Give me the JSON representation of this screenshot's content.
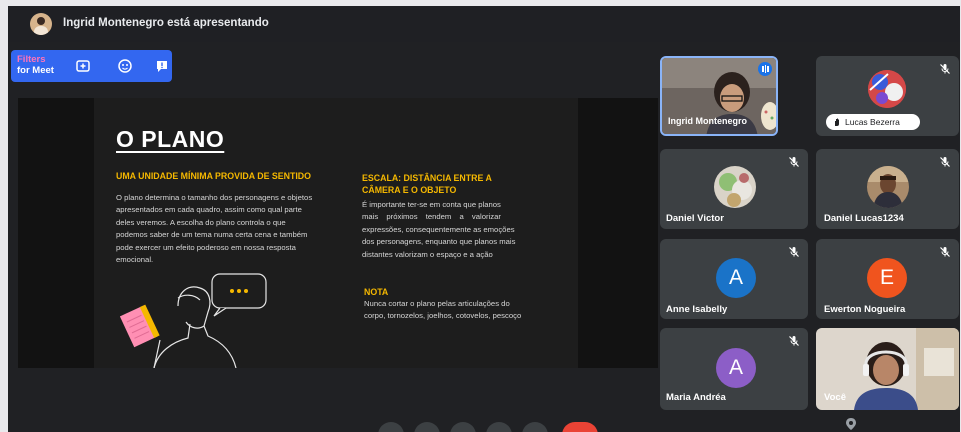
{
  "banner": {
    "text": "Ingrid Montenegro está apresentando"
  },
  "filters": {
    "line1": "Filters",
    "line2": "for Meet"
  },
  "slide": {
    "title": "O PLANO",
    "left_heading": "UMA UNIDADE MÍNIMA PROVIDA DE SENTIDO",
    "left_lines": [
      "O plano determina o tamanho dos personagens e objetos",
      "apresentados em cada quadro, assim como qual parte",
      "deles veremos. A escolha do plano controla o que",
      "podemos saber de um tema numa certa cena e também",
      "pode exercer um efeito poderoso em nossa resposta",
      "emocional."
    ],
    "right_heading_1": "ESCALA: DISTÂNCIA ENTRE A",
    "right_heading_2": "CÂMERA E O OBJETO",
    "right_lines": [
      "É importante ter-se em conta que planos",
      "mais próximos tendem a valorizar",
      "expressões, consequentemente as emoções",
      "dos personagens, enquanto que planos mais",
      "distantes valorizam o espaço e a ação"
    ],
    "note_heading": "NOTA",
    "note_lines": [
      "Nunca cortar o plano pelas articulações do",
      "corpo, tornozelos, joelhos, cotovelos, pescoço"
    ]
  },
  "participants": {
    "ingrid": {
      "name": "Ingrid Montenegro"
    },
    "lucas_b": {
      "name": "Lucas Bezerra"
    },
    "daniel_v": {
      "name": "Daniel Victor"
    },
    "daniel_l": {
      "name": "Daniel Lucas1234"
    },
    "anne": {
      "name": "Anne Isabelly",
      "initial": "A"
    },
    "ewerton": {
      "name": "Ewerton Nogueira",
      "initial": "E"
    },
    "maria": {
      "name": "Maria Andréa",
      "initial": "A"
    },
    "voce": {
      "name": "Você"
    }
  },
  "colors": {
    "anne": "#1a73c8",
    "ewerton": "#f0541e",
    "maria": "#8c5ec7",
    "active_border": "#8ab4f8",
    "slide_accent": "#f5b800"
  }
}
